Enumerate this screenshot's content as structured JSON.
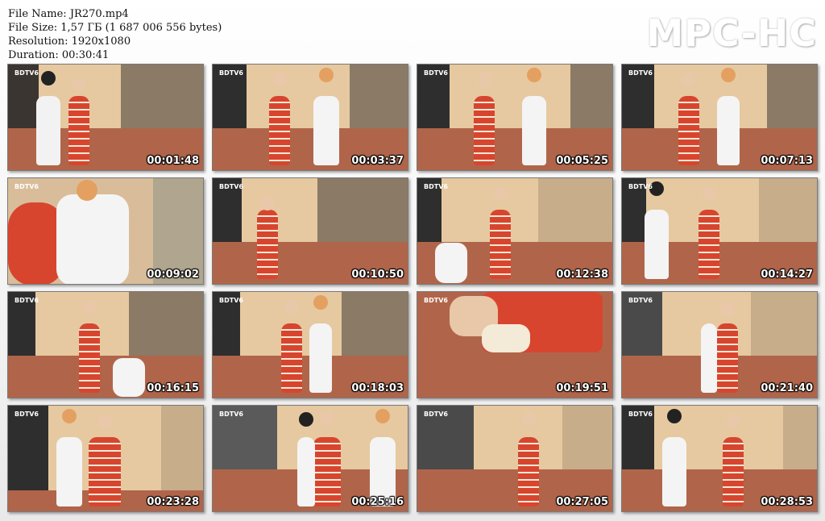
{
  "info": {
    "file_name": "File Name: JR270.mp4",
    "file_size": "File Size: 1,57 ГБ (1 687 006 556 bytes)",
    "resolution": "Resolution: 1920x1080",
    "duration": "Duration: 00:30:41"
  },
  "logo": "MPC-HC",
  "brand": "BDTV6",
  "thumbnails": [
    {
      "time": "00:01:48"
    },
    {
      "time": "00:03:37"
    },
    {
      "time": "00:05:25"
    },
    {
      "time": "00:07:13"
    },
    {
      "time": "00:09:02"
    },
    {
      "time": "00:10:50"
    },
    {
      "time": "00:12:38"
    },
    {
      "time": "00:14:27"
    },
    {
      "time": "00:16:15"
    },
    {
      "time": "00:18:03"
    },
    {
      "time": "00:19:51"
    },
    {
      "time": "00:21:40"
    },
    {
      "time": "00:23:28"
    },
    {
      "time": "00:25:16"
    },
    {
      "time": "00:27:05"
    },
    {
      "time": "00:28:53"
    }
  ],
  "colors": {
    "wall": "#e6c9a0",
    "shadow_wall": "#8b7a66",
    "floor": "#b0654a",
    "dress_red": "#d8452e",
    "rope": "#f4ead8"
  }
}
